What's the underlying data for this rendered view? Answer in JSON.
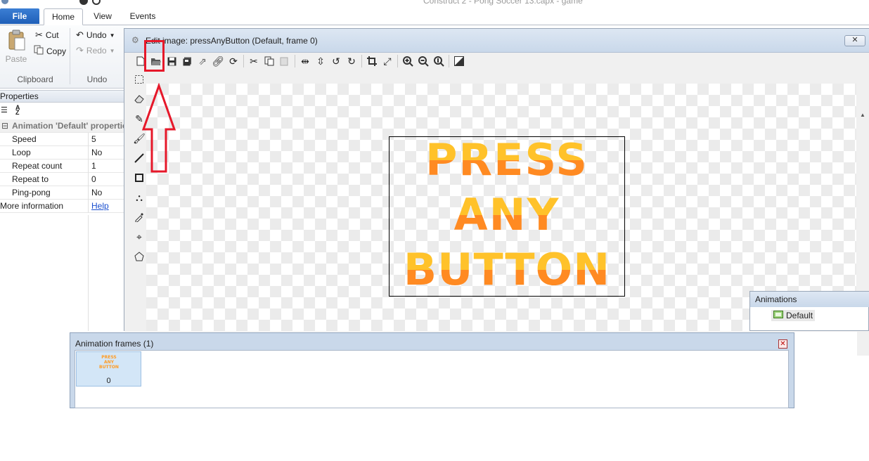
{
  "window": {
    "title": "Construct 2 - Pong Soccer 13.capx - game"
  },
  "ribbon": {
    "tabs": {
      "file": "File",
      "home": "Home",
      "view": "View",
      "events": "Events"
    },
    "clipboard": {
      "paste": "Paste",
      "cut": "Cut",
      "copy": "Copy",
      "group": "Clipboard"
    },
    "undo": {
      "undo": "Undo",
      "redo": "Redo",
      "group": "Undo"
    }
  },
  "properties": {
    "header": "Properties",
    "category": "Animation 'Default' properties",
    "rows": [
      {
        "key": "Speed",
        "value": "5"
      },
      {
        "key": "Loop",
        "value": "No"
      },
      {
        "key": "Repeat count",
        "value": "1"
      },
      {
        "key": "Repeat to",
        "value": "0"
      },
      {
        "key": "Ping-pong",
        "value": "No"
      }
    ],
    "more_info": {
      "key": "More information",
      "link": "Help"
    }
  },
  "editor": {
    "title": "Edit image: pressAnyButton (Default, frame 0)",
    "close": "✕",
    "image_lines": [
      "PRESS",
      "ANY",
      "BUTTON"
    ]
  },
  "animations": {
    "title": "Animations",
    "item": "Default"
  },
  "frames": {
    "title": "Animation frames (1)",
    "items": [
      {
        "label": "0",
        "thumb": "PRESS ANY BUTTON"
      }
    ]
  },
  "colors": {
    "annotation": "#e6182a",
    "text_top": "#ffc22a",
    "text_bottom": "#ff8a22",
    "file_tab": "#2a6cc6"
  },
  "icons": {
    "toolbar": [
      "new-icon",
      "open-icon",
      "save-icon",
      "save-all-icon",
      "export-icon",
      "link-icon",
      "refresh-icon",
      "cut-icon",
      "copy-icon",
      "paste-icon",
      "flip-horizontal-icon",
      "flip-vertical-icon",
      "rotate-ccw-icon",
      "rotate-cw-icon",
      "crop-icon",
      "resize-icon",
      "zoom-in-icon",
      "zoom-out-icon",
      "zoom-reset-icon",
      "image-icon"
    ],
    "tools": [
      "select-rect-icon",
      "eraser-icon",
      "pencil-icon",
      "brush-icon",
      "line-icon",
      "rectangle-icon",
      "fill-icon",
      "eyedropper-icon",
      "origin-point-icon",
      "collision-poly-icon"
    ]
  }
}
